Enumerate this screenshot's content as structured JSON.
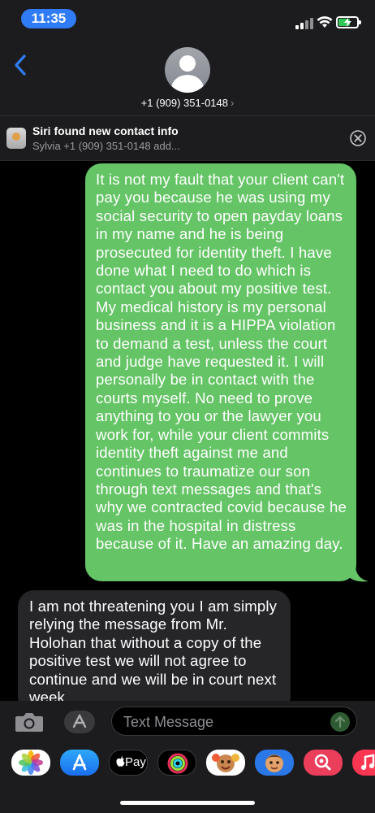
{
  "status_bar": {
    "time": "11:35"
  },
  "header": {
    "contact_number": "+1 (909) 351-0148",
    "chevron": "›",
    "back_icon": "chevron-left-icon"
  },
  "siri_banner": {
    "title": "Siri found new contact info",
    "subtitle": "Sylvia +1 (909) 351-0148  add..."
  },
  "messages": [
    {
      "direction": "outgoing",
      "text": "It is not my fault that your client can't pay you because he was using my social security to open payday loans in my name and he is being prosecuted for identity theft. I have done what I need to do which is contact you about my positive test. My medical history is my personal business and it is a HIPPA violation to demand a test, unless the court and judge have requested it. I will personally be in contact with the courts myself. No need to prove anything to you or the lawyer you work for, while your client commits identity theft against me and continues to traumatize our son through text messages and that's why we contracted covid because he was in the hospital in distress because of it. Have an amazing day."
    },
    {
      "direction": "incoming",
      "text": "I am not threatening you I am simply relying the message from Mr. Holohan that without a copy of the positive test we will not agree to continue and we will be in court next week."
    }
  ],
  "input": {
    "placeholder": "Text Message"
  },
  "app_drawer": {
    "apps": [
      "Photos",
      "App Store",
      "Apple Pay",
      "Activity",
      "Memoji",
      "Memoji Stickers",
      "Search Images",
      "Music"
    ],
    "apple_pay_label": "Pay"
  },
  "colors": {
    "outgoing_bubble": "#65c466",
    "incoming_bubble": "#262629",
    "accent_blue": "#2f7cf6"
  }
}
